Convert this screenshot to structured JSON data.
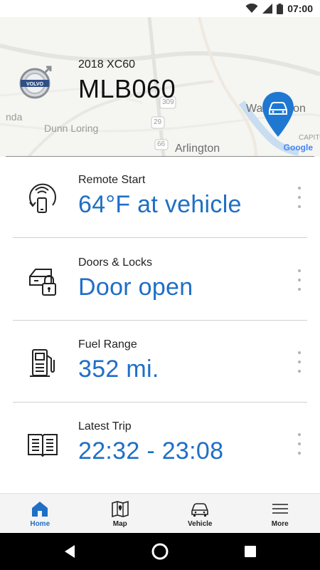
{
  "status_bar": {
    "time": "07:00",
    "icons": [
      "wifi-icon",
      "signal-icon",
      "battery-icon"
    ]
  },
  "header": {
    "model": "2018 XC60",
    "plate": "MLB060",
    "logo_label": "VOLVO",
    "map": {
      "labels": [
        "Dunn Loring",
        "Arlington",
        "Washington",
        "CAPITO",
        "309",
        "29",
        "66",
        "nda"
      ],
      "attribution": "Google"
    }
  },
  "cards": [
    {
      "label": "Remote Start",
      "value": "64°F at vehicle",
      "icon": "remote-start-icon"
    },
    {
      "label": "Doors & Locks",
      "value": "Door open",
      "icon": "door-lock-icon"
    },
    {
      "label": "Fuel Range",
      "value": "352 mi.",
      "icon": "fuel-pump-icon"
    },
    {
      "label": "Latest Trip",
      "value": "22:32 - 23:08",
      "icon": "logbook-icon"
    }
  ],
  "bottom_nav": [
    {
      "label": "Home",
      "icon": "home-icon",
      "active": true
    },
    {
      "label": "Map",
      "icon": "map-icon",
      "active": false
    },
    {
      "label": "Vehicle",
      "icon": "car-icon",
      "active": false
    },
    {
      "label": "More",
      "icon": "menu-icon",
      "active": false
    }
  ],
  "colors": {
    "accent": "#1f6fc6",
    "pin": "#1e78d2",
    "divider": "#cfcfcf"
  }
}
